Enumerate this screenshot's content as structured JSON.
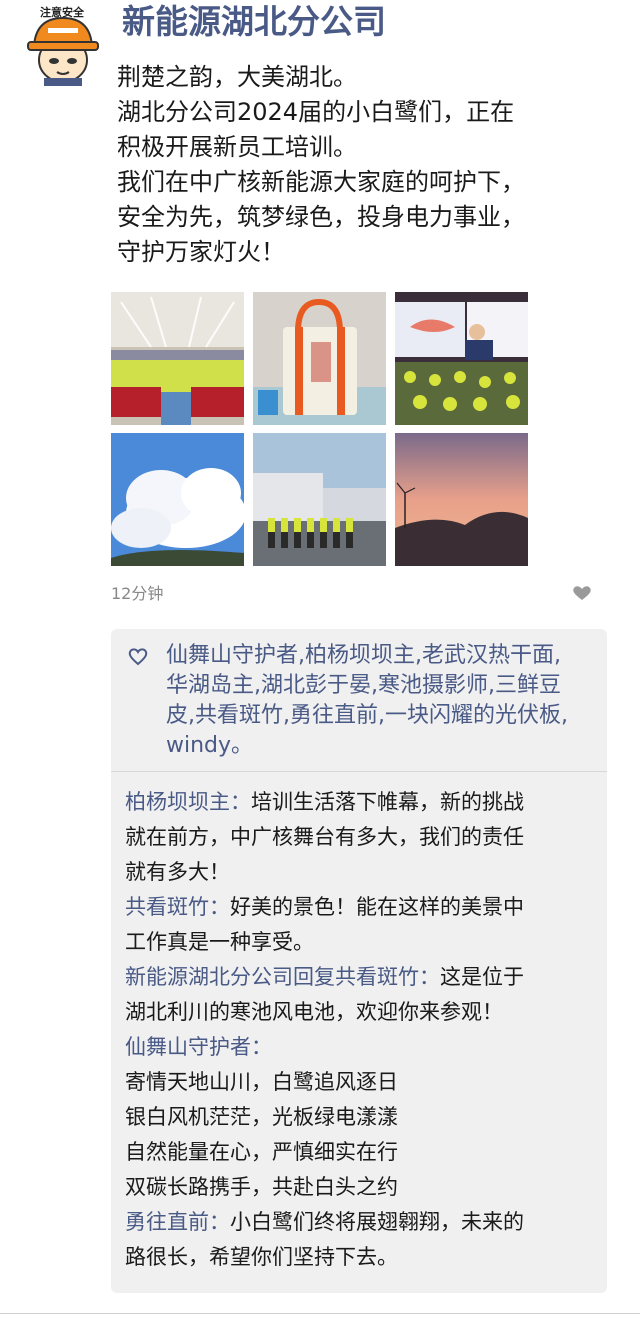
{
  "post": {
    "author": "新能源湖北分公司",
    "avatar_caption": "注意安全",
    "text_lines": [
      "荆楚之韵，大美湖北。",
      "湖北分公司2024届的小白鹭们，正在",
      "积极开展新员工培训。",
      "我们在中广核新能源大家庭的呵护下，",
      "安全为先，筑梦绿色，投身电力事业，",
      "守护万家灯火！"
    ],
    "time": "12分钟",
    "photos": [
      {
        "name": "photo-training-hall"
      },
      {
        "name": "photo-bag"
      },
      {
        "name": "photo-lecture"
      },
      {
        "name": "photo-clouds"
      },
      {
        "name": "photo-group-march"
      },
      {
        "name": "photo-sunset-turbines"
      }
    ]
  },
  "likes": {
    "icon": "heart-outline-icon",
    "lines": [
      "仙舞山守护者,柏杨坝坝主,老武汉热干面,",
      "华湖岛主,湖北彭于晏,寒池摄影师,三鲜豆",
      "皮,共看斑竹,勇往直前,一块闪耀的光伏板,",
      "windy。"
    ]
  },
  "comments": [
    {
      "author": "柏杨坝坝主：",
      "lines": [
        "培训生活落下帷幕，新的挑战",
        "就在前方，中广核舞台有多大，我们的责任",
        "就有多大！"
      ]
    },
    {
      "author": "共看斑竹：",
      "lines": [
        "好美的景色！能在这样的美景中",
        "工作真是一种享受。"
      ]
    },
    {
      "author": "新能源湖北分公司回复共看斑竹：",
      "lines": [
        "这是位于",
        "湖北利川的寒池风电池，欢迎你来参观！"
      ]
    },
    {
      "author": "仙舞山守护者：",
      "lines": [
        "",
        "寄情天地山川，白鹭追风逐日",
        "银白风机茫茫，光板绿电漾漾",
        "自然能量在心，严慎细实在行",
        "双碳长路携手，共赴白头之约"
      ]
    },
    {
      "author": "勇往直前：",
      "lines": [
        "小白鹭们终将展翅翱翔，未来的",
        "路很长，希望你们坚持下去。"
      ]
    }
  ]
}
